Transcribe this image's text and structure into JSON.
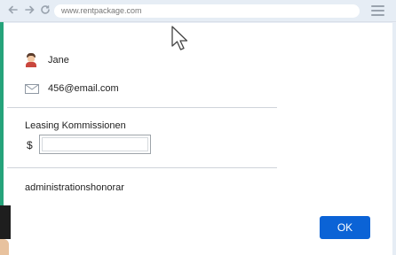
{
  "browser": {
    "url": "www.rentpackage.com",
    "icons": [
      "back-arrow-icon",
      "forward-arrow-icon",
      "refresh-icon",
      "hamburger-menu-icon"
    ]
  },
  "form": {
    "name": "Jane",
    "email": "456@email.com",
    "leasing_label": "Leasing Kommissionen",
    "currency_symbol": "$",
    "amount_value": "",
    "admin_fee_label": "administrationshonorar",
    "ok_label": "OK"
  },
  "colors": {
    "accent_button": "#0b63d6",
    "frame_border": "#25a37a"
  }
}
